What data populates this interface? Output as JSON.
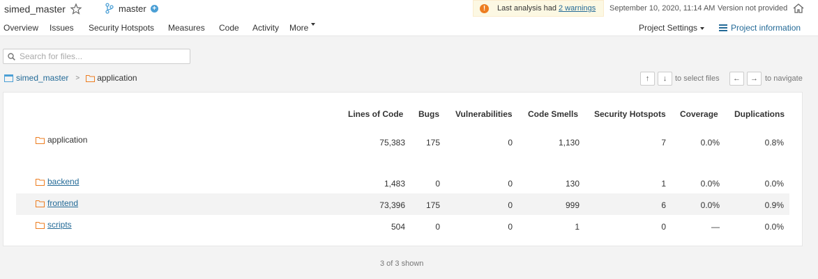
{
  "project": {
    "name": "simed_master",
    "branch": "master"
  },
  "header": {
    "warning_prefix": "Last analysis had",
    "warning_link": "2 warnings",
    "date": "September 10, 2020, 11:14 AM",
    "version": "Version not provided"
  },
  "nav": {
    "items": [
      "Overview",
      "Issues",
      "Security Hotspots",
      "Measures",
      "Code",
      "Activity",
      "More"
    ],
    "active": "Code",
    "project_settings": "Project Settings",
    "project_information": "Project information"
  },
  "search": {
    "placeholder": "Search for files..."
  },
  "breadcrumb": {
    "root": "simed_master",
    "current": "application"
  },
  "shortcuts": {
    "up": "↑",
    "down": "↓",
    "select_label": "to select files",
    "left": "←",
    "right": "→",
    "navigate_label": "to navigate"
  },
  "table": {
    "columns": [
      "Lines of Code",
      "Bugs",
      "Vulnerabilities",
      "Code Smells",
      "Security Hotspots",
      "Coverage",
      "Duplications"
    ],
    "rows": [
      {
        "name": "application",
        "link": false,
        "values": [
          "75,383",
          "175",
          "0",
          "1,130",
          "7",
          "0.0%",
          "0.8%"
        ]
      },
      {
        "name": "backend",
        "link": true,
        "values": [
          "1,483",
          "0",
          "0",
          "130",
          "1",
          "0.0%",
          "0.0%"
        ]
      },
      {
        "name": "frontend",
        "link": true,
        "values": [
          "73,396",
          "175",
          "0",
          "999",
          "6",
          "0.0%",
          "0.9%"
        ]
      },
      {
        "name": "scripts",
        "link": true,
        "values": [
          "504",
          "0",
          "0",
          "1",
          "0",
          "—",
          "0.0%"
        ]
      }
    ]
  },
  "footer": {
    "shown": "3 of 3 shown"
  },
  "colors": {
    "accent": "#4b9fd5",
    "link": "#236a97",
    "warning": "#ed7d20"
  }
}
